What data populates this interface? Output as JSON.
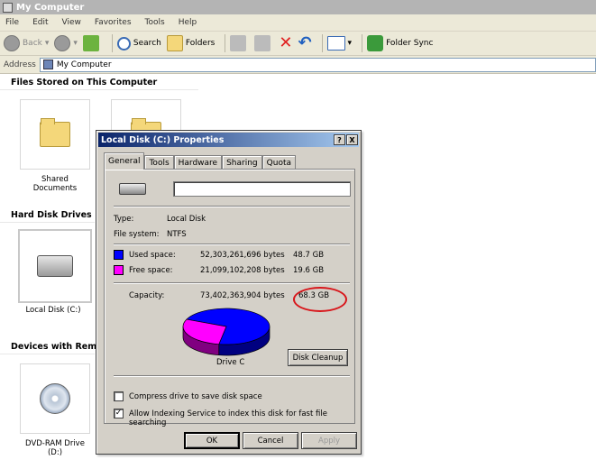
{
  "window": {
    "title": "My Computer"
  },
  "menu": [
    "File",
    "Edit",
    "View",
    "Favorites",
    "Tools",
    "Help"
  ],
  "toolbar": {
    "back": "Back",
    "search": "Search",
    "folders": "Folders",
    "folder_sync": "Folder Sync"
  },
  "address": {
    "label": "Address",
    "value": "My Computer"
  },
  "groups": {
    "files": "Files Stored on This Computer",
    "hdd": "Hard Disk Drives",
    "devices": "Devices with Remov"
  },
  "items": {
    "shared": "Shared Documents",
    "localdisk": "Local Disk (C:)",
    "dvd": "DVD-RAM Drive (D:)"
  },
  "dialog": {
    "title": "Local Disk (C:) Properties",
    "help_btn": "?",
    "close_btn": "X",
    "tabs": [
      "General",
      "Tools",
      "Hardware",
      "Sharing",
      "Quota"
    ],
    "name_value": "",
    "type_label": "Type:",
    "type_value": "Local Disk",
    "fs_label": "File system:",
    "fs_value": "NTFS",
    "used_label": "Used space:",
    "used_bytes": "52,303,261,696 bytes",
    "used_gb": "48.7 GB",
    "free_label": "Free space:",
    "free_bytes": "21,099,102,208 bytes",
    "free_gb": "19.6 GB",
    "cap_label": "Capacity:",
    "cap_bytes": "73,402,363,904 bytes",
    "cap_gb": "68.3 GB",
    "drive_label": "Drive C",
    "cleanup": "Disk Cleanup",
    "compress": "Compress drive to save disk space",
    "indexing": "Allow Indexing Service to index this disk for fast file searching",
    "compress_checked": false,
    "indexing_checked": true,
    "ok": "OK",
    "cancel": "Cancel",
    "apply": "Apply"
  },
  "colors": {
    "used": "#0000ff",
    "free": "#ff00ff",
    "annotation": "#d8161b"
  },
  "chart": {
    "used_fraction": 0.7126,
    "free_fraction": 0.2874
  }
}
